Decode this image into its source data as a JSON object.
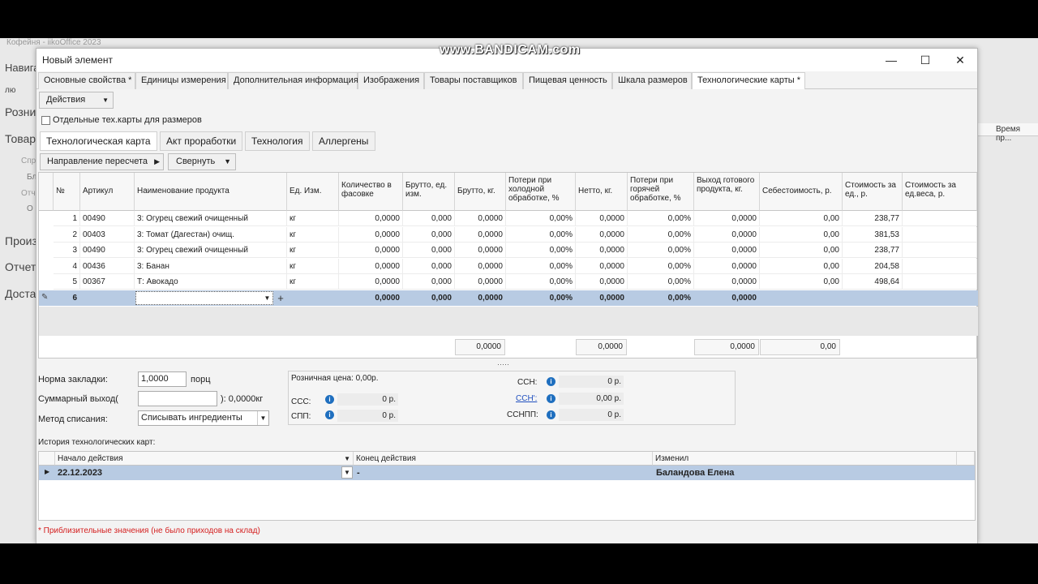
{
  "background": {
    "app_title": "Кофейня - iikoOffice 2023",
    "sidebar": [
      "Навига",
      "лю",
      "Розни",
      "Товар",
      "Спр",
      "Бл",
      "Отч",
      "О",
      "Произ",
      "Отчет",
      "Доста"
    ],
    "right_col": "Время пр..."
  },
  "watermark": "www.BANDICAM.com",
  "window": {
    "title": "Новый элемент"
  },
  "tabs": [
    "Основные свойства *",
    "Единицы измерения",
    "Дополнительная информация",
    "Изображения",
    "Товары поставщиков",
    "Пищевая ценность",
    "Шкала размеров",
    "Технологические карты *"
  ],
  "actions_label": "Действия",
  "separate_cards_label": "Отдельные тех.карты для размеров",
  "subtabs": [
    "Технологическая карта",
    "Акт проработки",
    "Технология",
    "Аллергены"
  ],
  "toolbar": {
    "recalc": "Направление пересчета",
    "collapse": "Свернуть"
  },
  "grid": {
    "headers": [
      "№",
      "Артикул",
      "Наименование продукта",
      "Ед. Изм.",
      "Количество в фасовке",
      "Брутто, ед. изм.",
      "Брутто, кг.",
      "Потери при холодной обработке, %",
      "Нетто, кг.",
      "Потери при горячей обработке, %",
      "Выход готового продукта, кг.",
      "Себестоимость, р.",
      "Стоимость за ед., р.",
      "Стоимость за ед.веса, р."
    ],
    "rows": [
      [
        "1",
        "00490",
        "3: Огурец свежий очищенный",
        "кг",
        "0,0000",
        "0,000",
        "0,0000",
        "0,00%",
        "0,0000",
        "0,00%",
        "0,0000",
        "0,00",
        "238,77",
        ""
      ],
      [
        "2",
        "00403",
        "3: Томат (Дагестан) очищ.",
        "кг",
        "0,0000",
        "0,000",
        "0,0000",
        "0,00%",
        "0,0000",
        "0,00%",
        "0,0000",
        "0,00",
        "381,53",
        ""
      ],
      [
        "3",
        "00490",
        "3: Огурец свежий очищенный",
        "кг",
        "0,0000",
        "0,000",
        "0,0000",
        "0,00%",
        "0,0000",
        "0,00%",
        "0,0000",
        "0,00",
        "238,77",
        ""
      ],
      [
        "4",
        "00436",
        "3: Банан",
        "кг",
        "0,0000",
        "0,000",
        "0,0000",
        "0,00%",
        "0,0000",
        "0,00%",
        "0,0000",
        "0,00",
        "204,58",
        ""
      ],
      [
        "5",
        "00367",
        "Т: Авокадо",
        "кг",
        "0,0000",
        "0,000",
        "0,0000",
        "0,00%",
        "0,0000",
        "0,00%",
        "0,0000",
        "0,00",
        "498,64",
        ""
      ],
      [
        "6",
        "",
        "",
        "",
        "0,0000",
        "0,000",
        "0,0000",
        "0,00%",
        "0,0000",
        "0,00%",
        "0,0000",
        "",
        "",
        ""
      ]
    ],
    "totals": {
      "brutto_kg": "0,0000",
      "netto": "0,0000",
      "output": "0,0000",
      "cost": "0,00"
    }
  },
  "form": {
    "norm_label": "Норма закладки:",
    "norm_value": "1,0000",
    "norm_unit": "порц",
    "sum_label": "Суммарный выход(",
    "sum_suffix": "): 0,0000кг",
    "method_label": "Метод списания:",
    "method_value": "Списывать ингредиенты"
  },
  "info": {
    "retail": "Розничная цена: 0,00р.",
    "ccc_label": "ССС:",
    "ccc_value": "0 р.",
    "spp_label": "СПП:",
    "spp_value": "0 р.",
    "csn_label": "ССН:",
    "csn_value": "0 р.",
    "csn2_label": "ССН':",
    "csn2_value": "0,00 р.",
    "csnpp_label": "ССНПП:",
    "csnpp_value": "0 р."
  },
  "history": {
    "title": "История технологических карт:",
    "headers": [
      "Начало действия",
      "Конец действия",
      "Изменил"
    ],
    "row": [
      "22.12.2023",
      "-",
      "Баландова Елена"
    ]
  },
  "note": "* Приблизительные значения (не было приходов на склад)",
  "colors": {
    "selection": "#b8cbe3",
    "info_icon": "#1f6fbf",
    "note": "#d42020"
  }
}
